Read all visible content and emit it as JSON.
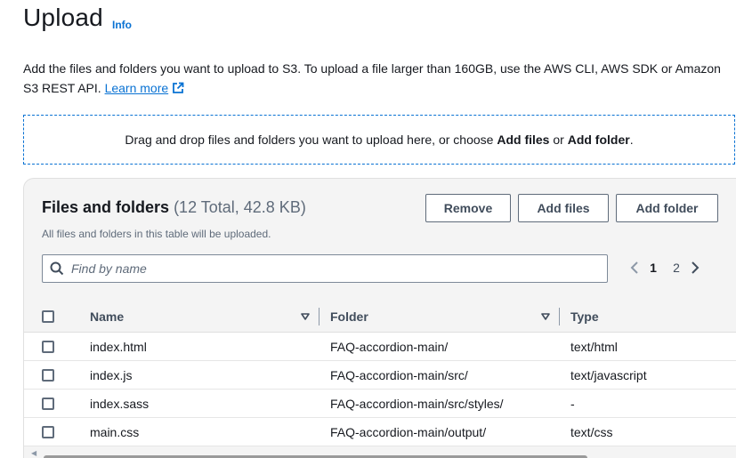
{
  "header": {
    "title": "Upload",
    "info_label": "Info"
  },
  "description": {
    "text": "Add the files and folders you want to upload to S3. To upload a file larger than 160GB, use the AWS CLI, AWS SDK or Amazon S3 REST API.",
    "learn_more_label": "Learn more"
  },
  "dropzone": {
    "prefix": "Drag and drop files and folders you want to upload here, or choose ",
    "add_files": "Add files",
    "middle": " or ",
    "add_folder": "Add folder",
    "suffix": "."
  },
  "files_panel": {
    "title": "Files and folders",
    "count": "(12 Total, 42.8 KB)",
    "subtitle": "All files and folders in this table will be uploaded.",
    "buttons": {
      "remove": "Remove",
      "add_files": "Add files",
      "add_folder": "Add folder"
    },
    "search": {
      "placeholder": "Find by name",
      "value": ""
    },
    "pagination": {
      "pages": [
        "1",
        "2"
      ],
      "current": "1"
    },
    "columns": {
      "name": "Name",
      "folder": "Folder",
      "type": "Type"
    },
    "rows": [
      {
        "name": "index.html",
        "folder": "FAQ-accordion-main/",
        "type": "text/html"
      },
      {
        "name": "index.js",
        "folder": "FAQ-accordion-main/src/",
        "type": "text/javascript"
      },
      {
        "name": "index.sass",
        "folder": "FAQ-accordion-main/src/styles/",
        "type": "-"
      },
      {
        "name": "main.css",
        "folder": "FAQ-accordion-main/output/",
        "type": "text/css"
      }
    ]
  },
  "colors": {
    "link": "#0972d3",
    "text": "#16191f",
    "muted": "#5f6b7a",
    "panel_bg": "#f4f4f4"
  },
  "icons": {
    "external_link": "external-link-icon",
    "search": "search-icon",
    "sort": "caret-down-icon",
    "prev": "chevron-left-icon",
    "next": "chevron-right-icon"
  }
}
